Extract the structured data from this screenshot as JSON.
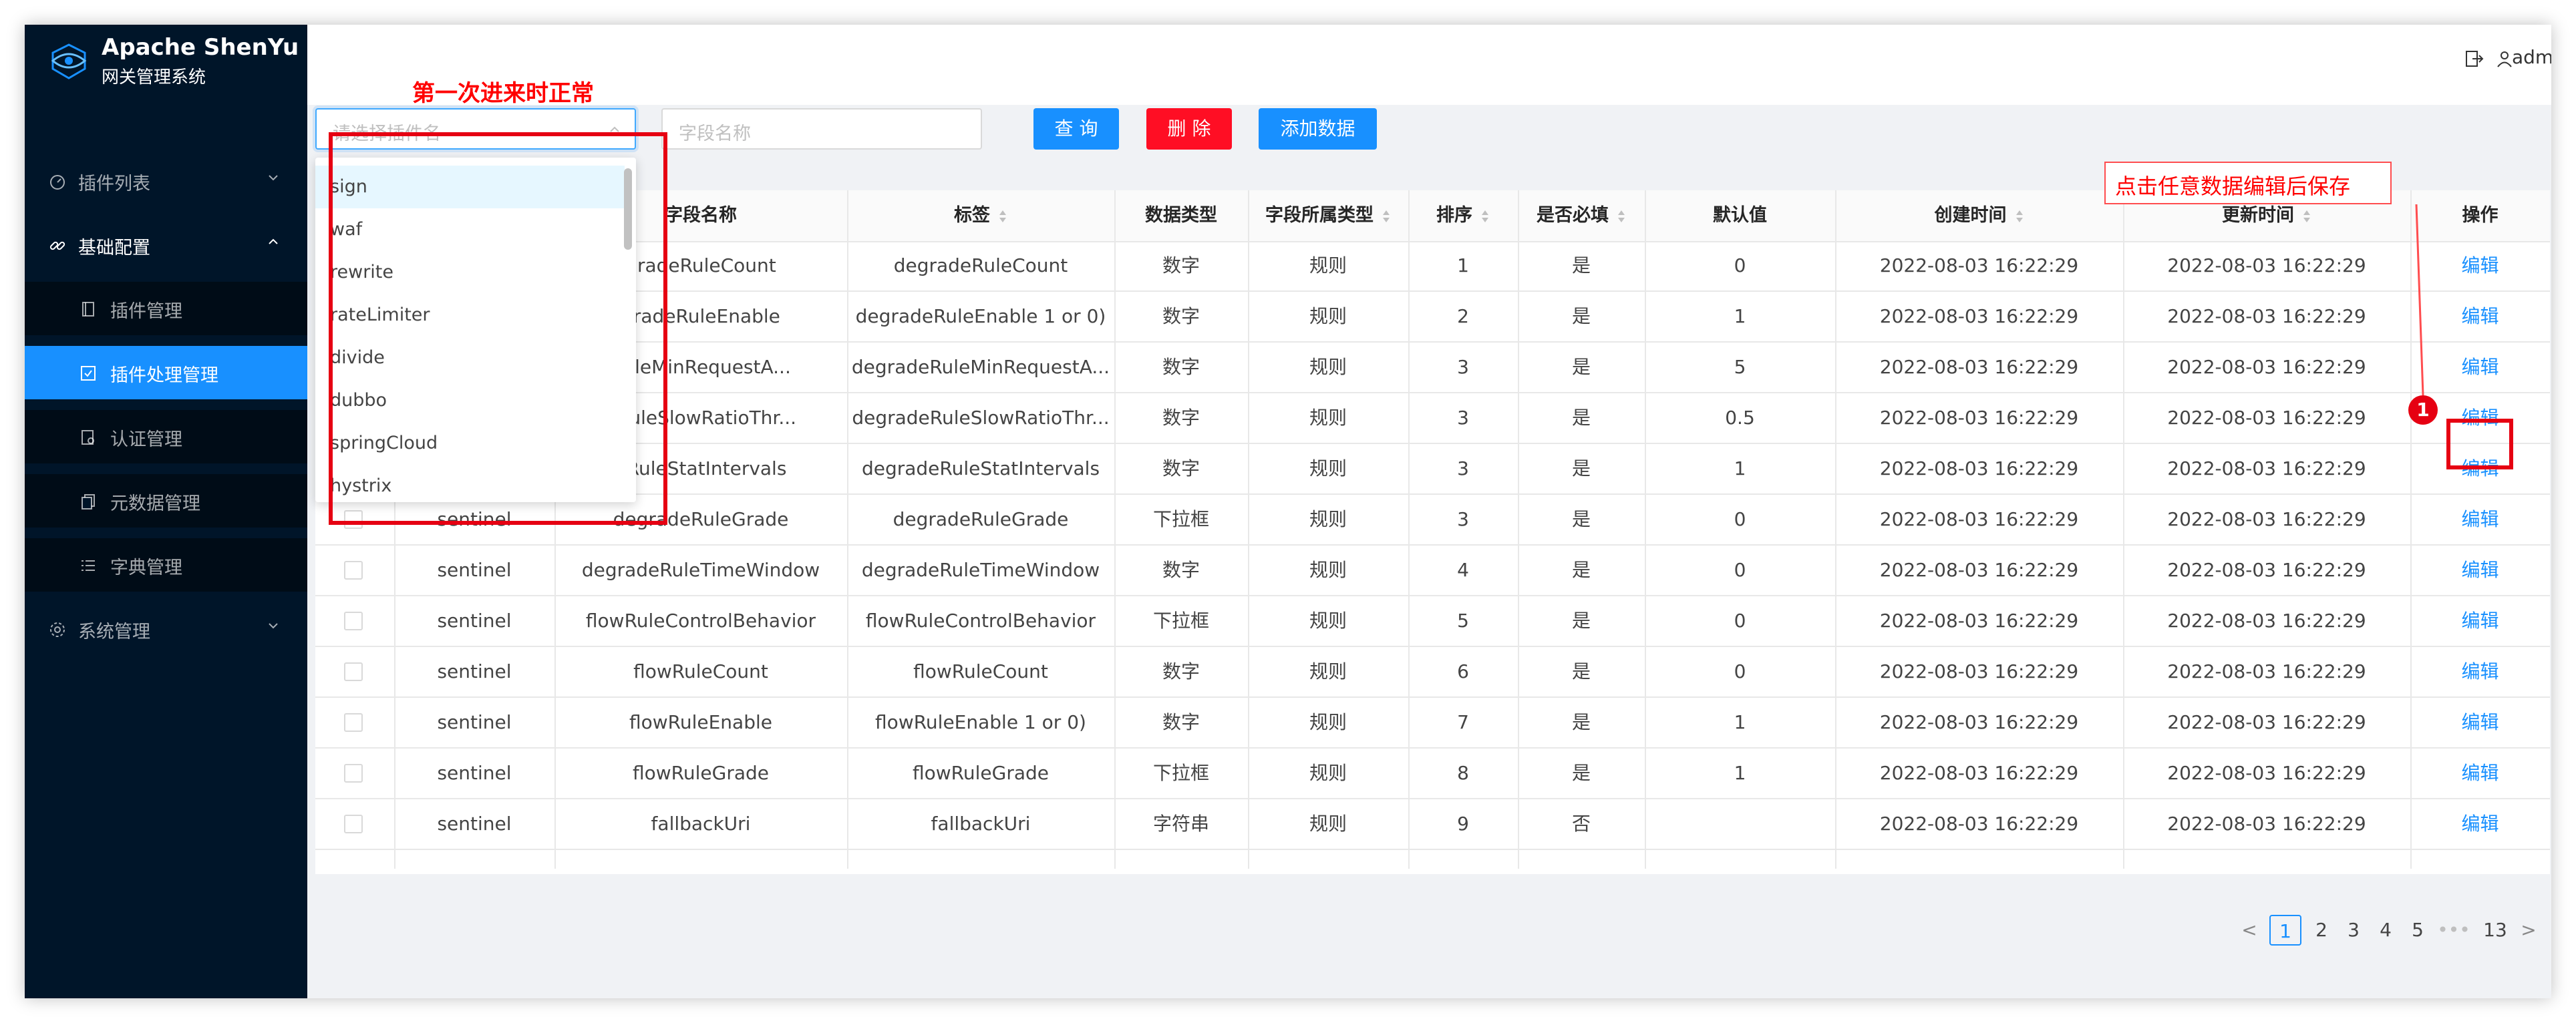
{
  "app": {
    "title": "Apache ShenYu",
    "subtitle": "网关管理系统"
  },
  "header": {
    "user_name": "admin"
  },
  "sidebar": {
    "items": [
      {
        "label": "插件列表",
        "icon": "dashboard-icon",
        "level": "top",
        "expanded": false
      },
      {
        "label": "基础配置",
        "icon": "link-icon",
        "level": "top",
        "expanded": true
      },
      {
        "label": "插件管理",
        "icon": "book-icon",
        "level": "sub"
      },
      {
        "label": "插件处理管理",
        "icon": "check-square-icon",
        "level": "sub",
        "selected": true
      },
      {
        "label": "认证管理",
        "icon": "audit-icon",
        "level": "sub"
      },
      {
        "label": "元数据管理",
        "icon": "copy-icon",
        "level": "sub"
      },
      {
        "label": "字典管理",
        "icon": "list-icon",
        "level": "sub"
      },
      {
        "label": "系统管理",
        "icon": "setting-icon",
        "level": "top",
        "expanded": false
      }
    ]
  },
  "toolbar": {
    "plugin_select_placeholder": "请选择插件名",
    "field_input_placeholder": "字段名称",
    "query_label": "查 询",
    "delete_label": "删 除",
    "add_label": "添加数据"
  },
  "dropdown": {
    "options": [
      "sign",
      "waf",
      "rewrite",
      "rateLimiter",
      "divide",
      "dubbo",
      "springCloud",
      "hystrix"
    ],
    "active_index": 0
  },
  "table": {
    "columns": [
      "",
      "",
      "字段名称",
      "标签",
      "数据类型",
      "字段所属类型",
      "排序",
      "是否必填",
      "默认值",
      "创建时间",
      "更新时间",
      "操作"
    ],
    "rows": [
      [
        "",
        "",
        "gradeRuleCount",
        "degradeRuleCount",
        "数字",
        "规则",
        "1",
        "是",
        "0",
        "2022-08-03 16:22:29",
        "2022-08-03 16:22:29",
        "编辑"
      ],
      [
        "",
        "",
        "gradeRuleEnable",
        "degradeRuleEnable 1 or 0)",
        "数字",
        "规则",
        "2",
        "是",
        "1",
        "2022-08-03 16:22:29",
        "2022-08-03 16:22:29",
        "编辑"
      ],
      [
        "",
        "",
        "RuleMinRequestA...",
        "degradeRuleMinRequestA...",
        "数字",
        "规则",
        "3",
        "是",
        "5",
        "2022-08-03 16:22:29",
        "2022-08-03 16:22:29",
        "编辑"
      ],
      [
        "",
        "",
        "eRuleSlowRatioThr...",
        "degradeRuleSlowRatioThr...",
        "数字",
        "规则",
        "3",
        "是",
        "0.5",
        "2022-08-03 16:22:29",
        "2022-08-03 16:22:29",
        "编辑"
      ],
      [
        "",
        "",
        "eRuleStatIntervals",
        "degradeRuleStatIntervals",
        "数字",
        "规则",
        "3",
        "是",
        "1",
        "2022-08-03 16:22:29",
        "2022-08-03 16:22:29",
        "编辑"
      ],
      [
        "",
        "sentinel",
        "degradeRuleGrade",
        "degradeRuleGrade",
        "下拉框",
        "规则",
        "3",
        "是",
        "0",
        "2022-08-03 16:22:29",
        "2022-08-03 16:22:29",
        "编辑"
      ],
      [
        "",
        "sentinel",
        "degradeRuleTimeWindow",
        "degradeRuleTimeWindow",
        "数字",
        "规则",
        "4",
        "是",
        "0",
        "2022-08-03 16:22:29",
        "2022-08-03 16:22:29",
        "编辑"
      ],
      [
        "",
        "sentinel",
        "flowRuleControlBehavior",
        "flowRuleControlBehavior",
        "下拉框",
        "规则",
        "5",
        "是",
        "0",
        "2022-08-03 16:22:29",
        "2022-08-03 16:22:29",
        "编辑"
      ],
      [
        "",
        "sentinel",
        "flowRuleCount",
        "flowRuleCount",
        "数字",
        "规则",
        "6",
        "是",
        "0",
        "2022-08-03 16:22:29",
        "2022-08-03 16:22:29",
        "编辑"
      ],
      [
        "",
        "sentinel",
        "flowRuleEnable",
        "flowRuleEnable 1 or 0)",
        "数字",
        "规则",
        "7",
        "是",
        "1",
        "2022-08-03 16:22:29",
        "2022-08-03 16:22:29",
        "编辑"
      ],
      [
        "",
        "sentinel",
        "flowRuleGrade",
        "flowRuleGrade",
        "下拉框",
        "规则",
        "8",
        "是",
        "1",
        "2022-08-03 16:22:29",
        "2022-08-03 16:22:29",
        "编辑"
      ],
      [
        "",
        "sentinel",
        "fallbackUri",
        "fallbackUri",
        "字符串",
        "规则",
        "9",
        "否",
        "",
        "2022-08-03 16:22:29",
        "2022-08-03 16:22:29",
        "编辑"
      ]
    ],
    "sortable_columns": [
      3,
      5,
      6,
      7,
      9,
      10
    ]
  },
  "pagination": {
    "prev": "<",
    "pages": [
      "1",
      "2",
      "3",
      "4",
      "5"
    ],
    "ellipsis": "•••",
    "last": "13",
    "next": ">",
    "current": "1"
  },
  "annotations": {
    "note_top": "第一次进来时正常",
    "note_right": "点击任意数据编辑后保存",
    "marker": "1"
  },
  "colors": {
    "sidebar_bg": "#001529",
    "primary": "#1890ff",
    "danger": "#ff0e24",
    "annotation_red": "#e60012"
  }
}
